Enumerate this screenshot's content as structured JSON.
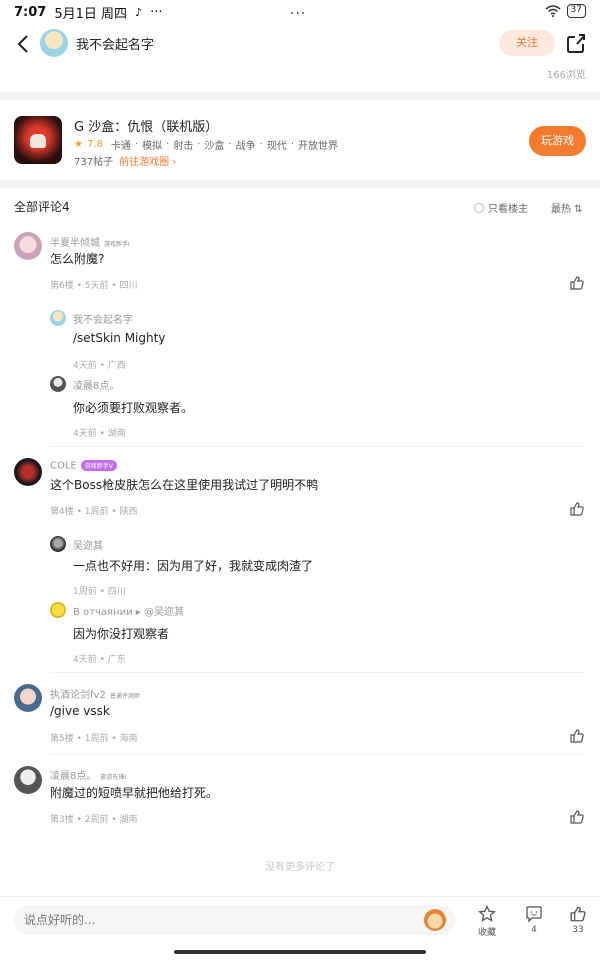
{
  "status_bar": {
    "time": "7:07",
    "date": "5月1日 周四",
    "extra": "···",
    "center": "···",
    "battery": "37"
  },
  "nav": {
    "author_name": "我不会起名字",
    "follow_label": "关注",
    "views": "166浏览"
  },
  "game": {
    "title": "G 沙盒：仇恨（联机版）",
    "rating": "7.8",
    "tags": [
      "卡通",
      "模拟",
      "射击",
      "沙盒",
      "战争",
      "现代",
      "开放世界"
    ],
    "posts": "737帖子",
    "link_label": "前往游戏圈 ›",
    "play_label": "玩游戏"
  },
  "comments_header": {
    "title": "全部评论4",
    "owner_only": "只看楼主",
    "sort": "最热 ⇅"
  },
  "comments": [
    {
      "name": "半夏半倾城",
      "badge": "游戏新手I",
      "text": "怎么附魔?",
      "meta": "第6楼 • 5天前 • 四川",
      "replies": [
        {
          "name": "我不会起名字",
          "text": "/setSkin Mighty",
          "meta": "4天前 • 广西"
        },
        {
          "name": "凌晨8点。",
          "text": "你必须要打败观察者。",
          "meta": "4天前 • 湖南"
        }
      ]
    },
    {
      "name": "COLE",
      "badge": "游戏新手V",
      "text": "这个Boss枪皮肤怎么在这里使用我试过了明明不鸭",
      "meta": "第4楼 • 1周前 • 陕西",
      "replies": [
        {
          "name": "吴迩其",
          "text": "一点也不好用：因为用了好，我就变成肉渣了",
          "meta": "1周前 • 四川"
        },
        {
          "name": "В отчаянии ▸ @吴迩其",
          "text": "因为你没打观察者",
          "meta": "4天前 • 广东"
        }
      ]
    },
    {
      "name": "执酒论剑fv2",
      "badge": "普通评测师",
      "text": "/give vssk",
      "meta": "第5楼 • 1周前 • 海南",
      "replies": []
    },
    {
      "name": "凌晨8点。",
      "badge": "旅游先锋I",
      "text": "附魔过的短喷早就把他给打死。",
      "meta": "第3楼 • 2周前 • 湖南",
      "replies": []
    }
  ],
  "no_more": "没有更多评论了",
  "bottom_bar": {
    "input_placeholder": "说点好听的...",
    "favorite_label": "收藏",
    "comment_count": "4",
    "like_count": "33"
  },
  "colors": {
    "accent": "#f27b2e",
    "follow_bg": "#fde9dd",
    "rating": "#f39c2a"
  }
}
